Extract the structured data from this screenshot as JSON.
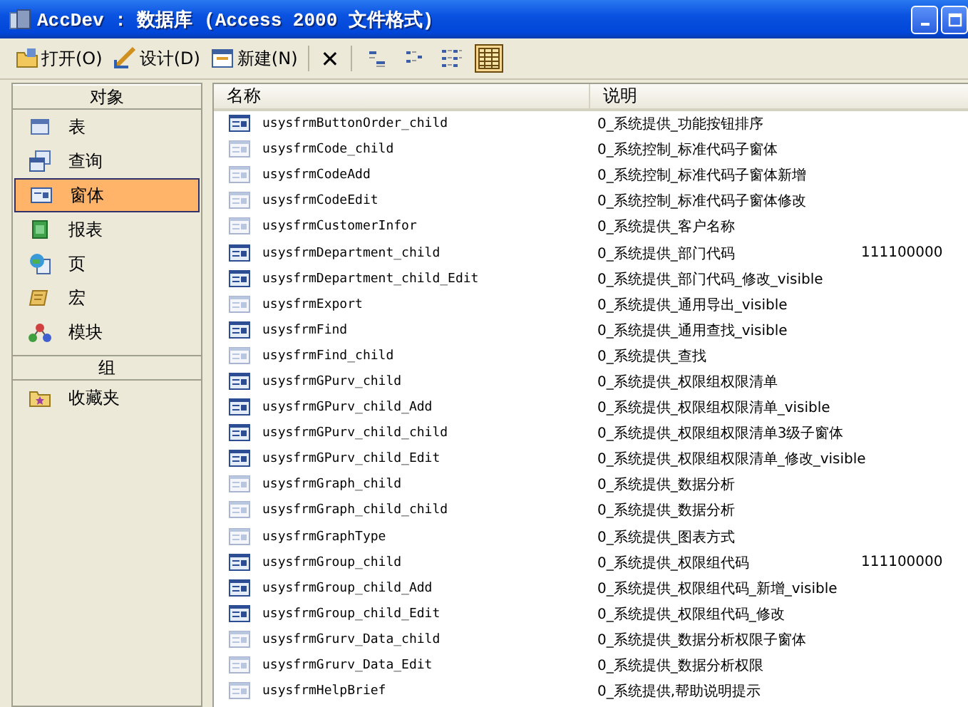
{
  "window": {
    "title": "AccDev : 数据库 (Access 2000 文件格式)"
  },
  "toolbar": [
    {
      "kind": "button",
      "label": "打开(O)"
    },
    {
      "kind": "button",
      "label": "设计(D)"
    },
    {
      "kind": "button",
      "label": "新建(N)"
    },
    {
      "kind": "separator"
    },
    {
      "kind": "delete",
      "label": "✕"
    },
    {
      "kind": "separator"
    },
    {
      "kind": "view",
      "selected": false
    },
    {
      "kind": "view",
      "selected": false
    },
    {
      "kind": "view",
      "selected": false
    },
    {
      "kind": "view",
      "selected": true
    }
  ],
  "sidebar": {
    "sections": [
      {
        "title": "对象",
        "items": [
          {
            "label": "表",
            "selected": false
          },
          {
            "label": "查询",
            "selected": false
          },
          {
            "label": "窗体",
            "selected": true
          },
          {
            "label": "报表",
            "selected": false
          },
          {
            "label": "页",
            "selected": false
          },
          {
            "label": "宏",
            "selected": false
          },
          {
            "label": "模块",
            "selected": false
          }
        ]
      },
      {
        "title": "组",
        "items": [
          {
            "label": "收藏夹",
            "selected": false
          }
        ]
      }
    ]
  },
  "table": {
    "columns": [
      "名称",
      "说明"
    ],
    "rows": [
      {
        "name": "usysfrmButtonOrder_child",
        "description": "0_系统提供_功能按钮排序",
        "hidden": false
      },
      {
        "name": "usysfrmCode_child",
        "description": "0_系统控制_标准代码子窗体",
        "hidden": true
      },
      {
        "name": "usysfrmCodeAdd",
        "description": "0_系统控制_标准代码子窗体新增",
        "hidden": true
      },
      {
        "name": "usysfrmCodeEdit",
        "description": "0_系统控制_标准代码子窗体修改",
        "hidden": true
      },
      {
        "name": "usysfrmCustomerInfor",
        "description": "0_系统提供_客户名称",
        "hidden": true
      },
      {
        "name": "usysfrmDepartment_child",
        "description": "0_系统提供_部门代码",
        "column_3": "111100000",
        "hidden": false
      },
      {
        "name": "usysfrmDepartment_child_Edit",
        "description": "0_系统提供_部门代码_修改_visible",
        "hidden": false
      },
      {
        "name": "usysfrmExport",
        "description": "0_系统提供_通用导出_visible",
        "hidden": true
      },
      {
        "name": "usysfrmFind",
        "description": "0_系统提供_通用查找_visible",
        "hidden": false
      },
      {
        "name": "usysfrmFind_child",
        "description": "0_系统提供_查找",
        "hidden": true
      },
      {
        "name": "usysfrmGPurv_child",
        "description": "0_系统提供_权限组权限清单",
        "hidden": false
      },
      {
        "name": "usysfrmGPurv_child_Add",
        "description": "0_系统提供_权限组权限清单_visible",
        "hidden": false
      },
      {
        "name": "usysfrmGPurv_child_child",
        "description": "0_系统提供_权限组权限清单3级子窗体",
        "hidden": false
      },
      {
        "name": "usysfrmGPurv_child_Edit",
        "description": "0_系统提供_权限组权限清单_修改_visible",
        "hidden": false
      },
      {
        "name": "usysfrmGraph_child",
        "description": "0_系统提供_数据分析",
        "hidden": true
      },
      {
        "name": "usysfrmGraph_child_child",
        "description": "0_系统提供_数据分析",
        "hidden": true
      },
      {
        "name": "usysfrmGraphType",
        "description": "0_系统提供_图表方式",
        "hidden": true
      },
      {
        "name": "usysfrmGroup_child",
        "description": "0_系统提供_权限组代码",
        "column_3": "111100000",
        "hidden": false
      },
      {
        "name": "usysfrmGroup_child_Add",
        "description": "0_系统提供_权限组代码_新增_visible",
        "hidden": false
      },
      {
        "name": "usysfrmGroup_child_Edit",
        "description": "0_系统提供_权限组代码_修改",
        "hidden": false
      },
      {
        "name": "usysfrmGrurv_Data_child",
        "description": "0_系统提供_数据分析权限子窗体",
        "hidden": true
      },
      {
        "name": "usysfrmGrurv_Data_Edit",
        "description": "0_系统提供_数据分析权限",
        "hidden": true
      },
      {
        "name": "usysfrmHelpBrief",
        "description": "0_系统提供,帮助说明提示",
        "hidden": true
      }
    ]
  }
}
